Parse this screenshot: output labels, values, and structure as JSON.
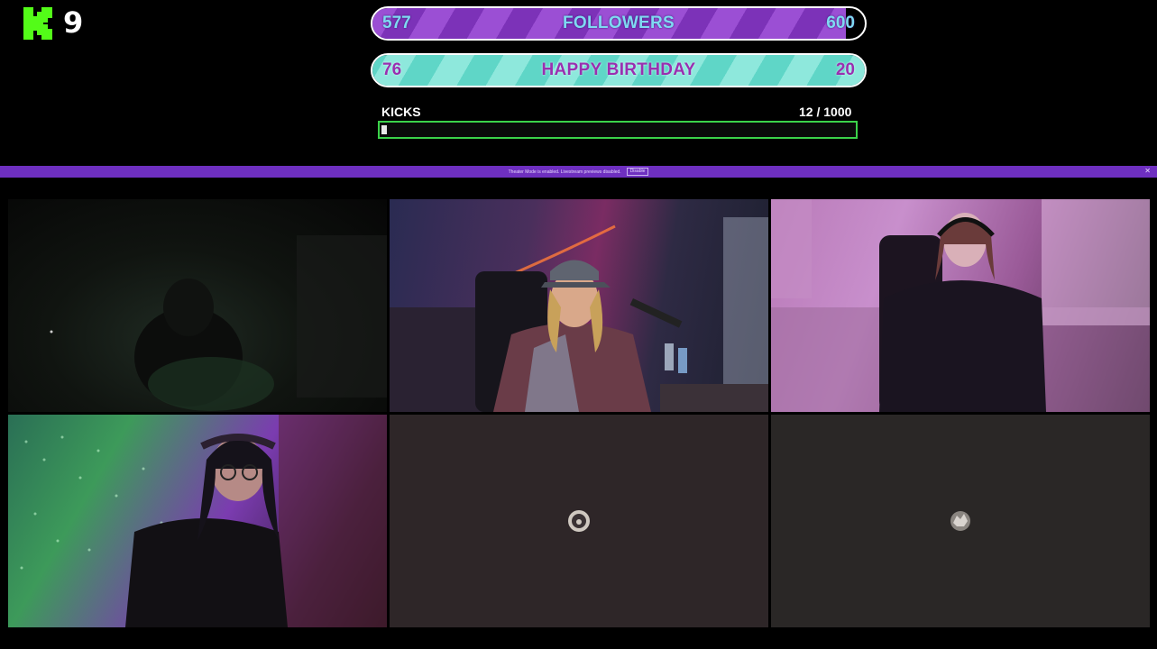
{
  "logo": {
    "icon": "kick-k-logo",
    "text": "9",
    "color": "#53fc18"
  },
  "goals": [
    {
      "current": "577",
      "title": "FOLLOWERS",
      "target": "600",
      "fill_fraction": 0.962
    },
    {
      "current": "76",
      "title": "HAPPY BIRTHDAY",
      "target": "20",
      "fill_fraction": 1.0
    }
  ],
  "kicks": {
    "label": "KICKS",
    "current": "12",
    "total": "1000",
    "count_text": "12  / 1000",
    "fill_fraction": 0.012
  },
  "banner": {
    "text": "Theater Mode is enabled. Livestream previews disabled.",
    "button": "Disable",
    "close": "✕"
  },
  "tiles": [
    {
      "name": "video-tile-1",
      "state": "camera on"
    },
    {
      "name": "video-tile-2",
      "state": "camera on"
    },
    {
      "name": "video-tile-3",
      "state": "camera on"
    },
    {
      "name": "video-tile-4",
      "state": "camera on"
    },
    {
      "name": "video-tile-5",
      "state": "camera off"
    },
    {
      "name": "video-tile-6",
      "state": "camera off"
    }
  ],
  "colors": {
    "accent_green": "#53fc18",
    "followers_purple": "#9b4fd4",
    "birthday_teal": "#8ee8dc",
    "banner_purple": "#6e2fc0"
  }
}
